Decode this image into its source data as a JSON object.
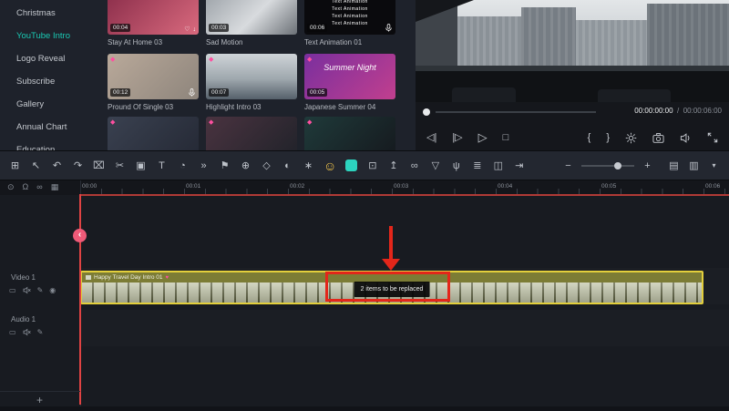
{
  "sidebar": {
    "items": [
      {
        "label": "Christmas"
      },
      {
        "label": "YouTube Intro"
      },
      {
        "label": "Logo Reveal"
      },
      {
        "label": "Subscribe"
      },
      {
        "label": "Gallery"
      },
      {
        "label": "Annual Chart"
      },
      {
        "label": "Education"
      }
    ]
  },
  "templates": {
    "cards": [
      {
        "name": "Stay At Home 03",
        "duration": "00:04"
      },
      {
        "name": "Sad Motion",
        "duration": "00:03"
      },
      {
        "name": "Text Animation 01",
        "duration": "00:06",
        "overlay_lines": [
          "Text Animation",
          "Text Animation",
          "Text Animation",
          "Text Animation"
        ]
      },
      {
        "name": "Pround Of Single 03",
        "duration": "00:12"
      },
      {
        "name": "Highlight Intro 03",
        "duration": "00:07"
      },
      {
        "name": "Japanese Summer 04",
        "duration": "00:05",
        "overlay_text": "Summer Night"
      }
    ]
  },
  "preview": {
    "current_time": "00:00:00:00",
    "separator": "/",
    "total_time": "00:00:06:00"
  },
  "transport": {
    "prev": "◁|",
    "next": "|▷",
    "play": "▷",
    "stop": "□",
    "mark_in": "{",
    "mark_out": "}"
  },
  "toolbar": {
    "left": [
      {
        "name": "media",
        "glyph": "⊞"
      },
      {
        "name": "select",
        "glyph": "↖"
      },
      {
        "name": "undo",
        "glyph": "↶"
      },
      {
        "name": "redo",
        "glyph": "↷"
      },
      {
        "name": "delete",
        "glyph": "⌧"
      },
      {
        "name": "split",
        "glyph": "✂"
      },
      {
        "name": "crop",
        "glyph": "▣"
      },
      {
        "name": "text",
        "glyph": "T"
      },
      {
        "name": "speed",
        "glyph": "◔"
      },
      {
        "name": "transition",
        "glyph": "»"
      },
      {
        "name": "marker",
        "glyph": "⚑"
      },
      {
        "name": "motion-track",
        "glyph": "⊕"
      },
      {
        "name": "keyframe",
        "glyph": "◇"
      },
      {
        "name": "mask",
        "glyph": "◐"
      },
      {
        "name": "effects",
        "glyph": "∗"
      }
    ],
    "smiley": "☺",
    "mid": [
      {
        "name": "plugin",
        "glyph": "⊡"
      },
      {
        "name": "export-frame",
        "glyph": "↥"
      },
      {
        "name": "link",
        "glyph": "∞"
      },
      {
        "name": "shield",
        "glyph": "▽"
      },
      {
        "name": "voiceover",
        "glyph": "ψ"
      },
      {
        "name": "mixer",
        "glyph": "≣"
      },
      {
        "name": "snapshot",
        "glyph": "◫"
      },
      {
        "name": "auto-ripple",
        "glyph": "⇥"
      }
    ],
    "zoom_minus": "−",
    "zoom_plus": "+",
    "right": [
      {
        "name": "track-height",
        "glyph": "▤"
      },
      {
        "name": "layout",
        "glyph": "▥"
      },
      {
        "name": "more",
        "glyph": "▾"
      }
    ]
  },
  "timeline": {
    "ruler": [
      "00:00",
      "00:01",
      "00:02",
      "00:03",
      "00:04",
      "00:05",
      "00:06"
    ],
    "gutter_icons": [
      {
        "name": "settings",
        "glyph": "⊙"
      },
      {
        "name": "magnet",
        "glyph": "Ω"
      },
      {
        "name": "link",
        "glyph": "∞"
      },
      {
        "name": "render",
        "glyph": "▦"
      }
    ],
    "tracks": [
      {
        "name": "Video 1"
      },
      {
        "name": "Audio 1"
      }
    ],
    "clip": {
      "title": "Happy Travel Day Intro 01",
      "overlay": "2 items to be replaced"
    },
    "add_track": "+"
  },
  "icons": {
    "heart": "♡",
    "heart_filled": "♥",
    "gem": "◆",
    "download": "↓",
    "folder": "▭",
    "wrench": "✎",
    "eye": "◉",
    "playhead_chevron": "‹"
  },
  "colors": {
    "accent_teal": "#1ac9b3",
    "annotation_red": "#e3261a",
    "clip_border": "#e3cf3c"
  }
}
